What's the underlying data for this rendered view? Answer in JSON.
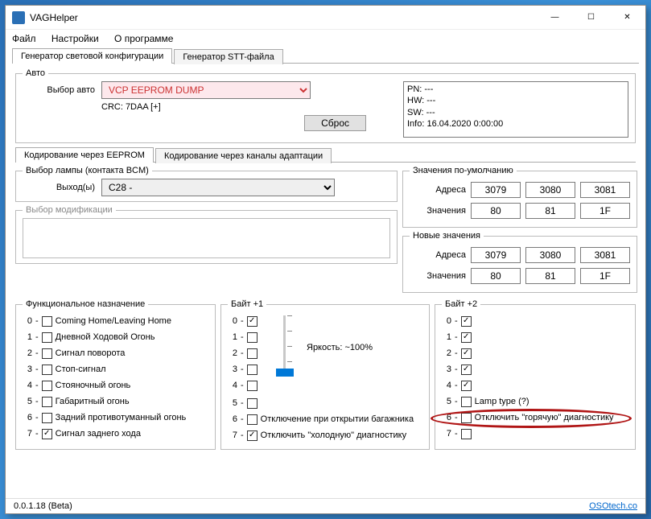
{
  "window": {
    "title": "VAGHelper"
  },
  "menu": {
    "file": "Файл",
    "settings": "Настройки",
    "about": "О программе"
  },
  "mainTabs": {
    "t1": "Генератор световой конфигурации",
    "t2": "Генератор STT-файла"
  },
  "auto": {
    "legend": "Авто",
    "selectLabel": "Выбор авто",
    "selectValue": "VCP EEPROM DUMP",
    "crc": "CRC: 7DAA [+]",
    "reset": "Сброс",
    "info": {
      "pn": "PN: ---",
      "hw": "HW: ---",
      "sw": "SW: ---",
      "inf": "Info: 16.04.2020 0:00:00"
    }
  },
  "subTabs": {
    "t1": "Кодирование через EEPROM",
    "t2": "Кодирование через каналы адаптации"
  },
  "lamp": {
    "legend": "Выбор лампы (контакта BCM)",
    "outLabel": "Выход(ы)",
    "outValue": "C28 -"
  },
  "mod": {
    "legend": "Выбор модификации"
  },
  "defaults": {
    "legend": "Значения по-умолчанию",
    "addrLabel": "Адреса",
    "addr": [
      "3079",
      "3080",
      "3081"
    ],
    "valLabel": "Значения",
    "val": [
      "80",
      "81",
      "1F"
    ]
  },
  "newvals": {
    "legend": "Новые значения",
    "addrLabel": "Адреса",
    "addr": [
      "3079",
      "3080",
      "3081"
    ],
    "valLabel": "Значения",
    "val": [
      "80",
      "81",
      "1F"
    ]
  },
  "func": {
    "legend": "Функциональное назначение",
    "items": [
      {
        "i": "0",
        "c": false,
        "t": "Coming Home/Leaving Home"
      },
      {
        "i": "1",
        "c": false,
        "t": "Дневной Ходовой Огонь"
      },
      {
        "i": "2",
        "c": false,
        "t": "Сигнал поворота"
      },
      {
        "i": "3",
        "c": false,
        "t": "Стоп-сигнал"
      },
      {
        "i": "4",
        "c": false,
        "t": "Стояночный огонь"
      },
      {
        "i": "5",
        "c": false,
        "t": "Габаритный огонь"
      },
      {
        "i": "6",
        "c": false,
        "t": "Задний противотуманный огонь"
      },
      {
        "i": "7",
        "c": true,
        "t": "Сигнал заднего хода"
      }
    ]
  },
  "byte1": {
    "legend": "Байт +1",
    "items": [
      {
        "i": "0",
        "c": true,
        "t": ""
      },
      {
        "i": "1",
        "c": false,
        "t": ""
      },
      {
        "i": "2",
        "c": false,
        "t": ""
      },
      {
        "i": "3",
        "c": false,
        "t": ""
      },
      {
        "i": "4",
        "c": false,
        "t": ""
      },
      {
        "i": "5",
        "c": false,
        "t": ""
      },
      {
        "i": "6",
        "c": false,
        "t": "Отключение при открытии багажника"
      },
      {
        "i": "7",
        "c": true,
        "t": "Отключить \"холодную\" диагностику"
      }
    ],
    "brightness": "Яркость: ~100%"
  },
  "byte2": {
    "legend": "Байт +2",
    "items": [
      {
        "i": "0",
        "c": true,
        "t": ""
      },
      {
        "i": "1",
        "c": true,
        "t": ""
      },
      {
        "i": "2",
        "c": true,
        "t": ""
      },
      {
        "i": "3",
        "c": true,
        "t": ""
      },
      {
        "i": "4",
        "c": true,
        "t": ""
      },
      {
        "i": "5",
        "c": false,
        "t": "Lamp type (?)"
      },
      {
        "i": "6",
        "c": false,
        "t": "Отключить \"горячую\" диагностику"
      },
      {
        "i": "7",
        "c": false,
        "t": ""
      }
    ]
  },
  "status": {
    "version": "0.0.1.18 (Beta)",
    "link": "OSOtech.co"
  }
}
